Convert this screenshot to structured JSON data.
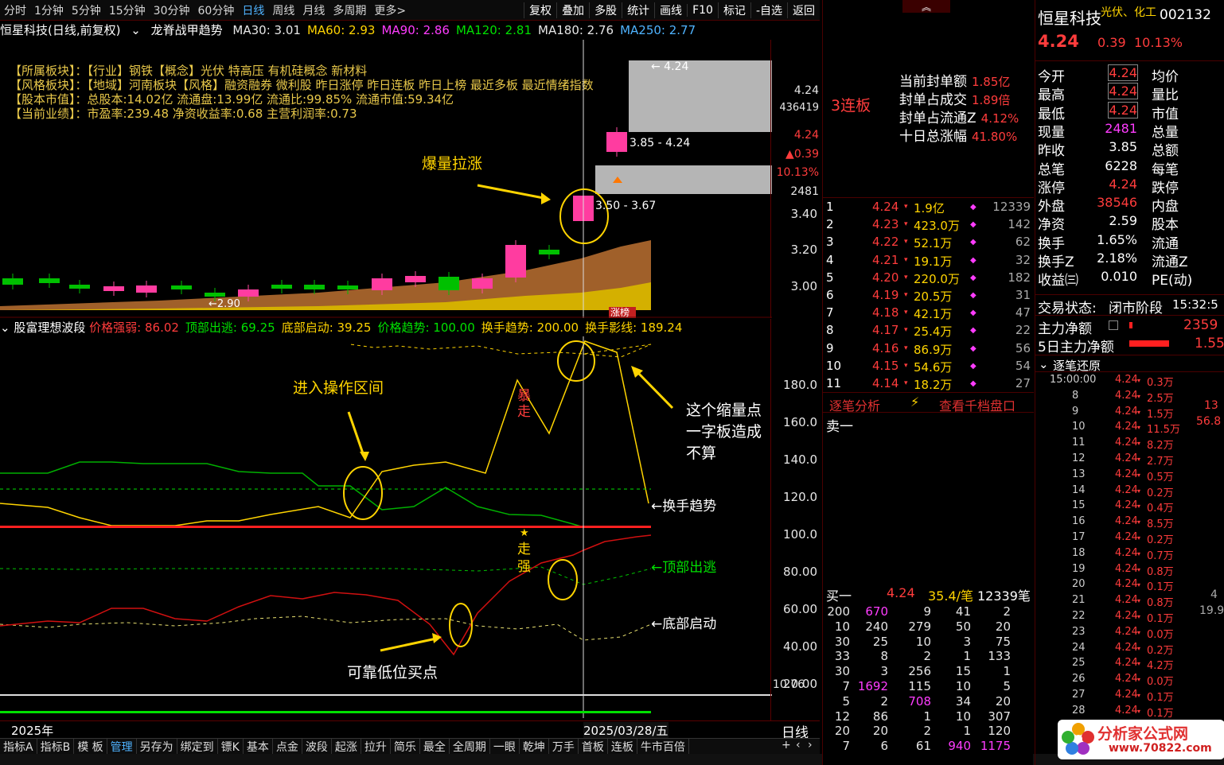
{
  "toolbar": {
    "periods": [
      "分时",
      "1分钟",
      "5分钟",
      "15分钟",
      "30分钟",
      "60分钟",
      "日线",
      "周线",
      "月线",
      "多周期",
      "更多>"
    ],
    "active": "日线",
    "right": [
      "复权",
      "叠加",
      "多股",
      "统计",
      "画线",
      "F10",
      "标记",
      "-自选",
      "返回"
    ]
  },
  "header": {
    "title": "恒星科技(日线,前复权)",
    "indicator": "龙脊战甲趋势",
    "ma": [
      {
        "label": "MA30: 3.01",
        "color": "#e6e6e6"
      },
      {
        "label": "MA60: 2.93",
        "color": "#ffd400"
      },
      {
        "label": "MA90: 2.86",
        "color": "#ff3cff"
      },
      {
        "label": "MA120: 2.81",
        "color": "#00e000"
      },
      {
        "label": "MA180: 2.76",
        "color": "#e6e6e6"
      },
      {
        "label": "MA250: 2.77",
        "color": "#4fb3ff"
      }
    ]
  },
  "info": {
    "lines": [
      "【所属板块】：【行业】钢铁【概念】光伏 特高压 有机硅概念 新材料",
      "【风格板块】：【地域】河南板块【风格】融资融券 微利股 昨日涨停 昨日连板 昨日上榜 最近多板 最近情绪指数",
      "【股本市值】：总股本:14.02亿 流通盘:13.99亿 流通比:99.85% 流通市值:59.34亿",
      "【当前业绩】：市盈率:239.48 净资收益率:0.68 主营利润率:0.73"
    ]
  },
  "main_chart": {
    "yticks": [
      "3.40",
      "3.20",
      "3.00"
    ],
    "side_values": [
      "4.24",
      "436419",
      "4.24",
      "▲0.39",
      "10.13%",
      "2481"
    ],
    "labels": {
      "top": "← 4.24",
      "mid": "3.85 - 4.24",
      "low": "3.50 - 3.67",
      "min": "←2.90",
      "tag": "涨榜"
    }
  },
  "annotations": {
    "a1": "爆量拉涨",
    "a2": "进入操作区间",
    "a3": "这个缩量点一字板造成不算",
    "a4": "可靠低位买点",
    "bao": "暴走",
    "zou": "走强",
    "tag_hs": "←换手趋势",
    "tag_db": "←顶部出逃",
    "tag_dq": "←底部启动"
  },
  "sub_chart": {
    "name": "股富理想波段",
    "params": [
      {
        "t": "价格强弱: 86.02",
        "c": "#ff3c3c"
      },
      {
        "t": "顶部出逃: 69.25",
        "c": "#00e000"
      },
      {
        "t": "底部启动: 39.25",
        "c": "#ffd400"
      },
      {
        "t": "价格趋势: 100.00",
        "c": "#00e000"
      },
      {
        "t": "换手趋势: 200.00",
        "c": "#ffd400"
      },
      {
        "t": "换手影线: 189.24",
        "c": "#ffd400"
      }
    ],
    "yticks": [
      "180.0",
      "160.0",
      "140.0",
      "120.0",
      "100.0",
      "80.00",
      "60.00",
      "40.00",
      "20.00"
    ],
    "bottom_val": "10.76"
  },
  "dates": {
    "left": "2025年",
    "cursor": "2025/03/28/五",
    "period": "日线"
  },
  "bottom_tabs": [
    "指标A",
    "指标B",
    "模 板",
    "管理",
    "另存为",
    "绑定到",
    "镖K",
    "基本",
    "点金",
    "波段",
    "起涨",
    "拉升",
    "简乐",
    "最全",
    "全周期",
    "一眼",
    "乾坤",
    "万手",
    "首板",
    "连板",
    "牛市百倍"
  ],
  "bottom_active": "管理",
  "seal": {
    "streak": "3连板",
    "rows": [
      {
        "k": "当前封单额",
        "v": "1.85亿"
      },
      {
        "k": "封单占成交",
        "v": "1.89倍"
      },
      {
        "k": "封单占流通Z",
        "v": "4.12%"
      },
      {
        "k": "十日总涨幅",
        "v": "41.80%"
      }
    ]
  },
  "orders": [
    {
      "n": "1",
      "p": "4.24",
      "a": "1.9亿",
      "v": "12339"
    },
    {
      "n": "2",
      "p": "4.23",
      "a": "423.0万",
      "v": "142"
    },
    {
      "n": "3",
      "p": "4.22",
      "a": "52.1万",
      "v": "62"
    },
    {
      "n": "4",
      "p": "4.21",
      "a": "19.1万",
      "v": "32"
    },
    {
      "n": "5",
      "p": "4.20",
      "a": "220.0万",
      "v": "182"
    },
    {
      "n": "6",
      "p": "4.19",
      "a": "20.5万",
      "v": "31"
    },
    {
      "n": "7",
      "p": "4.18",
      "a": "42.1万",
      "v": "47"
    },
    {
      "n": "8",
      "p": "4.17",
      "a": "25.4万",
      "v": "22"
    },
    {
      "n": "9",
      "p": "4.16",
      "a": "86.9万",
      "v": "56"
    },
    {
      "n": "10",
      "p": "4.15",
      "a": "54.6万",
      "v": "54"
    },
    {
      "n": "11",
      "p": "4.14",
      "a": "18.2万",
      "v": "27"
    }
  ],
  "tick_tabs": [
    "逐笔分析",
    "查看千档盘口"
  ],
  "sell1": "卖一",
  "buy1": {
    "label": "买一",
    "price": "4.24",
    "per": "35.4/笔",
    "vol": "12339笔"
  },
  "vol_rows": [
    [
      "200",
      "670",
      "9",
      "41",
      "2"
    ],
    [
      "10",
      "240",
      "279",
      "50",
      "20"
    ],
    [
      "30",
      "25",
      "10",
      "3",
      "75"
    ],
    [
      "33",
      "8",
      "2",
      "1",
      "133"
    ],
    [
      "30",
      "3",
      "256",
      "15",
      "1"
    ],
    [
      "7",
      "1692",
      "115",
      "10",
      "5"
    ],
    [
      "5",
      "2",
      "708",
      "34",
      "20"
    ],
    [
      "12",
      "86",
      "1",
      "10",
      "307"
    ],
    [
      "20",
      "20",
      "2",
      "1",
      "120"
    ],
    [
      "7",
      "6",
      "61",
      "940",
      "1175"
    ]
  ],
  "quote": {
    "name": "恒星科技",
    "tags": "光伏、化工",
    "code": "002132",
    "price": "4.24",
    "chg": "0.39",
    "pct": "10.13%",
    "rows": [
      {
        "l": "今开",
        "v": "4.24",
        "r": "均价"
      },
      {
        "l": "最高",
        "v": "4.24",
        "r": "量比"
      },
      {
        "l": "最低",
        "v": "4.24",
        "r": "市值"
      },
      {
        "l": "现量",
        "v": "2481",
        "r": "总量"
      },
      {
        "l": "昨收",
        "v": "3.85",
        "r": "总额"
      },
      {
        "l": "总笔",
        "v": "6228",
        "r": "每笔"
      },
      {
        "l": "涨停",
        "v": "4.24",
        "r": "跌停"
      },
      {
        "l": "外盘",
        "v": "38546",
        "r": "内盘"
      },
      {
        "l": "净资",
        "v": "2.59",
        "r": "股本"
      },
      {
        "l": "换手",
        "v": "1.65%",
        "r": "流通"
      },
      {
        "l": "换手Z",
        "v": "2.18%",
        "r": "流通Z"
      },
      {
        "l": "收益㈢",
        "v": "0.010",
        "r": "PE(动)"
      }
    ],
    "status_label": "交易状态:",
    "status": "闭市阶段",
    "time": "15:32:5",
    "main_net": "主力净额",
    "main_net_v": "2359",
    "net5": "5日主力净额",
    "net5_v": "1.55",
    "trace": "逐笔还原"
  },
  "ticks": [
    {
      "t": "15:00:00",
      "p": "4.24",
      "v": "0.3万"
    },
    {
      "t": "8",
      "p": "4.24",
      "v": "2.5万"
    },
    {
      "t": "9",
      "p": "4.24",
      "v": "1.5万"
    },
    {
      "t": "10",
      "p": "4.24",
      "v": "11.5万"
    },
    {
      "t": "11",
      "p": "4.24",
      "v": "8.2万"
    },
    {
      "t": "12",
      "p": "4.24",
      "v": "2.7万"
    },
    {
      "t": "13",
      "p": "4.24",
      "v": "0.5万"
    },
    {
      "t": "14",
      "p": "4.24",
      "v": "0.2万"
    },
    {
      "t": "15",
      "p": "4.24",
      "v": "0.4万"
    },
    {
      "t": "16",
      "p": "4.24",
      "v": "8.5万"
    },
    {
      "t": "17",
      "p": "4.24",
      "v": "0.2万"
    },
    {
      "t": "18",
      "p": "4.24",
      "v": "0.7万"
    },
    {
      "t": "19",
      "p": "4.24",
      "v": "0.8万"
    },
    {
      "t": "20",
      "p": "4.24",
      "v": "0.1万"
    },
    {
      "t": "21",
      "p": "4.24",
      "v": "0.8万"
    },
    {
      "t": "22",
      "p": "4.24",
      "v": "0.1万"
    },
    {
      "t": "23",
      "p": "4.24",
      "v": "0.0万"
    },
    {
      "t": "24",
      "p": "4.24",
      "v": "0.2万"
    },
    {
      "t": "25",
      "p": "4.24",
      "v": "4.2万"
    },
    {
      "t": "26",
      "p": "4.24",
      "v": "0.0万"
    },
    {
      "t": "27",
      "p": "4.24",
      "v": "0.1万"
    },
    {
      "t": "28",
      "p": "4.24",
      "v": "0.1万"
    }
  ],
  "edge": {
    "a": "13",
    "b": "56.8",
    "c": "4",
    "d": "19.9"
  },
  "logo": {
    "name": "分析家公式网",
    "url": "www.70822.com"
  },
  "watermark": "分析家公式网www.70822.com"
}
